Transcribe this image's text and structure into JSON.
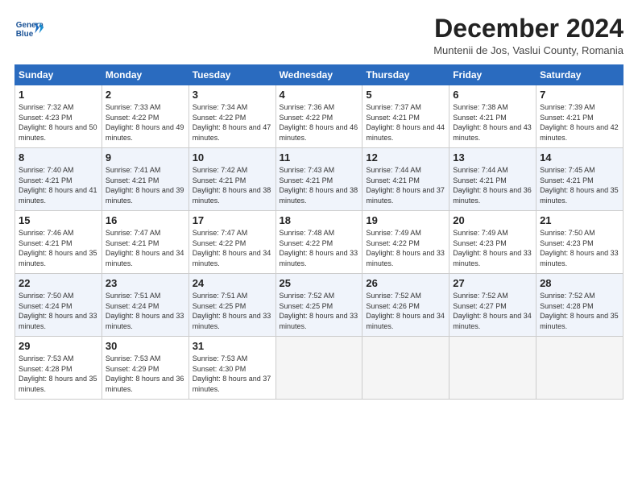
{
  "logo": {
    "line1": "General",
    "line2": "Blue"
  },
  "title": "December 2024",
  "subtitle": "Muntenii de Jos, Vaslui County, Romania",
  "headers": [
    "Sunday",
    "Monday",
    "Tuesday",
    "Wednesday",
    "Thursday",
    "Friday",
    "Saturday"
  ],
  "weeks": [
    [
      {
        "day": "1",
        "sunrise": "7:32 AM",
        "sunset": "4:23 PM",
        "daylight": "8 hours and 50 minutes."
      },
      {
        "day": "2",
        "sunrise": "7:33 AM",
        "sunset": "4:22 PM",
        "daylight": "8 hours and 49 minutes."
      },
      {
        "day": "3",
        "sunrise": "7:34 AM",
        "sunset": "4:22 PM",
        "daylight": "8 hours and 47 minutes."
      },
      {
        "day": "4",
        "sunrise": "7:36 AM",
        "sunset": "4:22 PM",
        "daylight": "8 hours and 46 minutes."
      },
      {
        "day": "5",
        "sunrise": "7:37 AM",
        "sunset": "4:21 PM",
        "daylight": "8 hours and 44 minutes."
      },
      {
        "day": "6",
        "sunrise": "7:38 AM",
        "sunset": "4:21 PM",
        "daylight": "8 hours and 43 minutes."
      },
      {
        "day": "7",
        "sunrise": "7:39 AM",
        "sunset": "4:21 PM",
        "daylight": "8 hours and 42 minutes."
      }
    ],
    [
      {
        "day": "8",
        "sunrise": "7:40 AM",
        "sunset": "4:21 PM",
        "daylight": "8 hours and 41 minutes."
      },
      {
        "day": "9",
        "sunrise": "7:41 AM",
        "sunset": "4:21 PM",
        "daylight": "8 hours and 39 minutes."
      },
      {
        "day": "10",
        "sunrise": "7:42 AM",
        "sunset": "4:21 PM",
        "daylight": "8 hours and 38 minutes."
      },
      {
        "day": "11",
        "sunrise": "7:43 AM",
        "sunset": "4:21 PM",
        "daylight": "8 hours and 38 minutes."
      },
      {
        "day": "12",
        "sunrise": "7:44 AM",
        "sunset": "4:21 PM",
        "daylight": "8 hours and 37 minutes."
      },
      {
        "day": "13",
        "sunrise": "7:44 AM",
        "sunset": "4:21 PM",
        "daylight": "8 hours and 36 minutes."
      },
      {
        "day": "14",
        "sunrise": "7:45 AM",
        "sunset": "4:21 PM",
        "daylight": "8 hours and 35 minutes."
      }
    ],
    [
      {
        "day": "15",
        "sunrise": "7:46 AM",
        "sunset": "4:21 PM",
        "daylight": "8 hours and 35 minutes."
      },
      {
        "day": "16",
        "sunrise": "7:47 AM",
        "sunset": "4:21 PM",
        "daylight": "8 hours and 34 minutes."
      },
      {
        "day": "17",
        "sunrise": "7:47 AM",
        "sunset": "4:22 PM",
        "daylight": "8 hours and 34 minutes."
      },
      {
        "day": "18",
        "sunrise": "7:48 AM",
        "sunset": "4:22 PM",
        "daylight": "8 hours and 33 minutes."
      },
      {
        "day": "19",
        "sunrise": "7:49 AM",
        "sunset": "4:22 PM",
        "daylight": "8 hours and 33 minutes."
      },
      {
        "day": "20",
        "sunrise": "7:49 AM",
        "sunset": "4:23 PM",
        "daylight": "8 hours and 33 minutes."
      },
      {
        "day": "21",
        "sunrise": "7:50 AM",
        "sunset": "4:23 PM",
        "daylight": "8 hours and 33 minutes."
      }
    ],
    [
      {
        "day": "22",
        "sunrise": "7:50 AM",
        "sunset": "4:24 PM",
        "daylight": "8 hours and 33 minutes."
      },
      {
        "day": "23",
        "sunrise": "7:51 AM",
        "sunset": "4:24 PM",
        "daylight": "8 hours and 33 minutes."
      },
      {
        "day": "24",
        "sunrise": "7:51 AM",
        "sunset": "4:25 PM",
        "daylight": "8 hours and 33 minutes."
      },
      {
        "day": "25",
        "sunrise": "7:52 AM",
        "sunset": "4:25 PM",
        "daylight": "8 hours and 33 minutes."
      },
      {
        "day": "26",
        "sunrise": "7:52 AM",
        "sunset": "4:26 PM",
        "daylight": "8 hours and 34 minutes."
      },
      {
        "day": "27",
        "sunrise": "7:52 AM",
        "sunset": "4:27 PM",
        "daylight": "8 hours and 34 minutes."
      },
      {
        "day": "28",
        "sunrise": "7:52 AM",
        "sunset": "4:28 PM",
        "daylight": "8 hours and 35 minutes."
      }
    ],
    [
      {
        "day": "29",
        "sunrise": "7:53 AM",
        "sunset": "4:28 PM",
        "daylight": "8 hours and 35 minutes."
      },
      {
        "day": "30",
        "sunrise": "7:53 AM",
        "sunset": "4:29 PM",
        "daylight": "8 hours and 36 minutes."
      },
      {
        "day": "31",
        "sunrise": "7:53 AM",
        "sunset": "4:30 PM",
        "daylight": "8 hours and 37 minutes."
      },
      null,
      null,
      null,
      null
    ]
  ]
}
